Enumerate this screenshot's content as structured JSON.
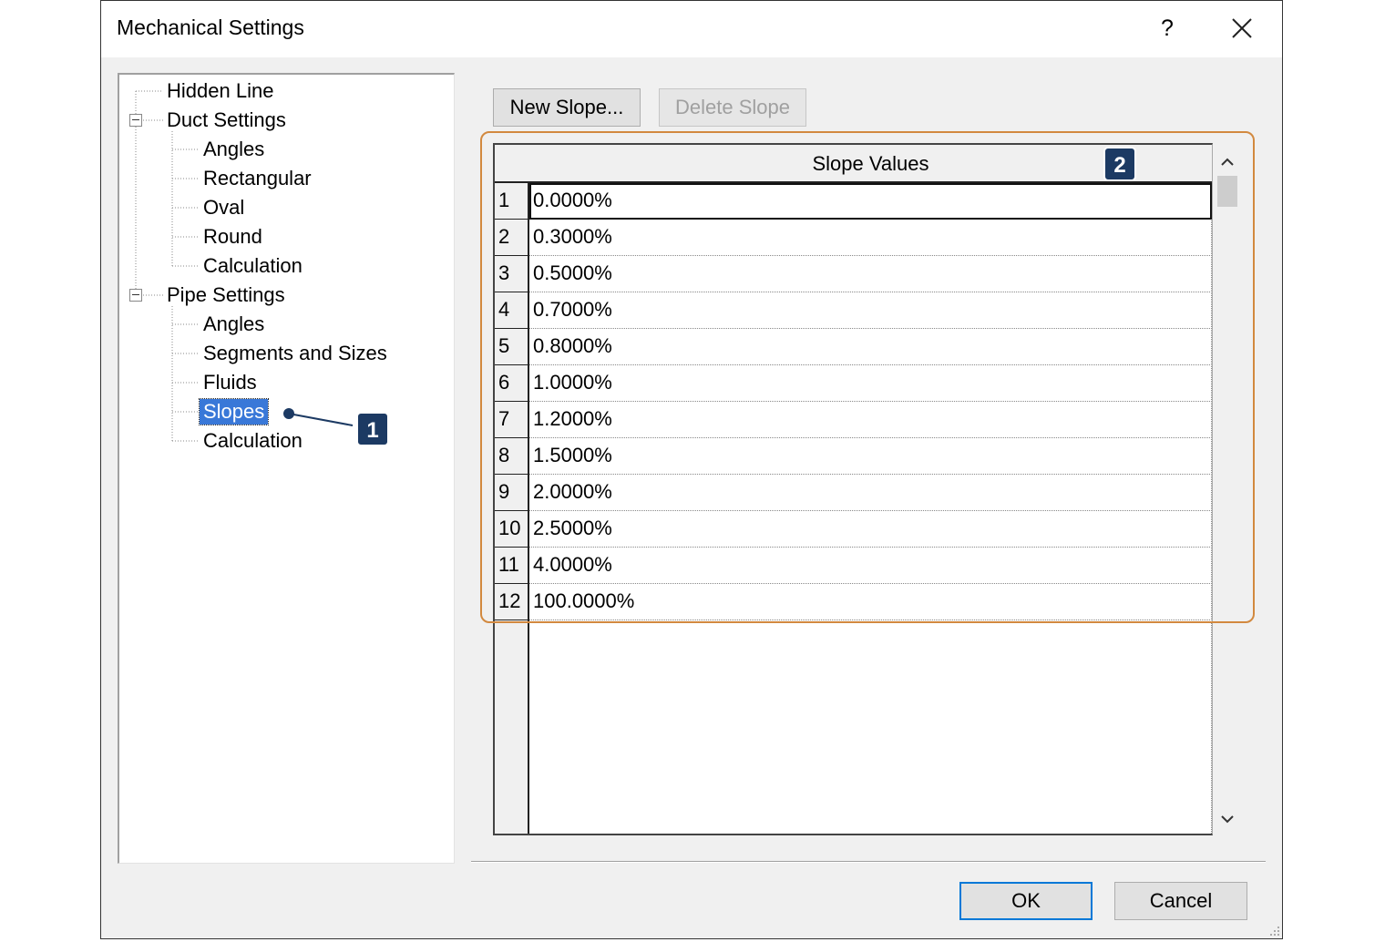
{
  "dialog": {
    "title": "Mechanical Settings",
    "help_label": "?",
    "close_icon": "close-icon"
  },
  "tree": {
    "items": [
      {
        "label": "Hidden Line"
      },
      {
        "label": "Duct Settings",
        "expanded": true
      },
      {
        "label": "Angles"
      },
      {
        "label": "Rectangular"
      },
      {
        "label": "Oval"
      },
      {
        "label": "Round"
      },
      {
        "label": "Calculation"
      },
      {
        "label": "Pipe Settings",
        "expanded": true
      },
      {
        "label": "Angles"
      },
      {
        "label": "Segments and Sizes"
      },
      {
        "label": "Fluids"
      },
      {
        "label": "Slopes",
        "selected": true
      },
      {
        "label": "Calculation"
      }
    ]
  },
  "toolbar": {
    "new_slope_label": "New Slope...",
    "delete_slope_label": "Delete Slope",
    "delete_slope_enabled": false
  },
  "grid": {
    "column_header": "Slope Values",
    "rows": [
      {
        "num": "1",
        "value": "0.0000%"
      },
      {
        "num": "2",
        "value": "0.3000%"
      },
      {
        "num": "3",
        "value": "0.5000%"
      },
      {
        "num": "4",
        "value": "0.7000%"
      },
      {
        "num": "5",
        "value": "0.8000%"
      },
      {
        "num": "6",
        "value": "1.0000%"
      },
      {
        "num": "7",
        "value": "1.2000%"
      },
      {
        "num": "8",
        "value": "1.5000%"
      },
      {
        "num": "9",
        "value": "2.0000%"
      },
      {
        "num": "10",
        "value": "2.5000%"
      },
      {
        "num": "11",
        "value": "4.0000%"
      },
      {
        "num": "12",
        "value": "100.0000%"
      }
    ]
  },
  "callouts": {
    "one": "1",
    "two": "2",
    "badge_color": "#1c3a63",
    "highlight_color": "#d2893f"
  },
  "footer": {
    "ok_label": "OK",
    "cancel_label": "Cancel"
  },
  "colors": {
    "selection": "#3978d8",
    "default_button_border": "#0078d7"
  }
}
